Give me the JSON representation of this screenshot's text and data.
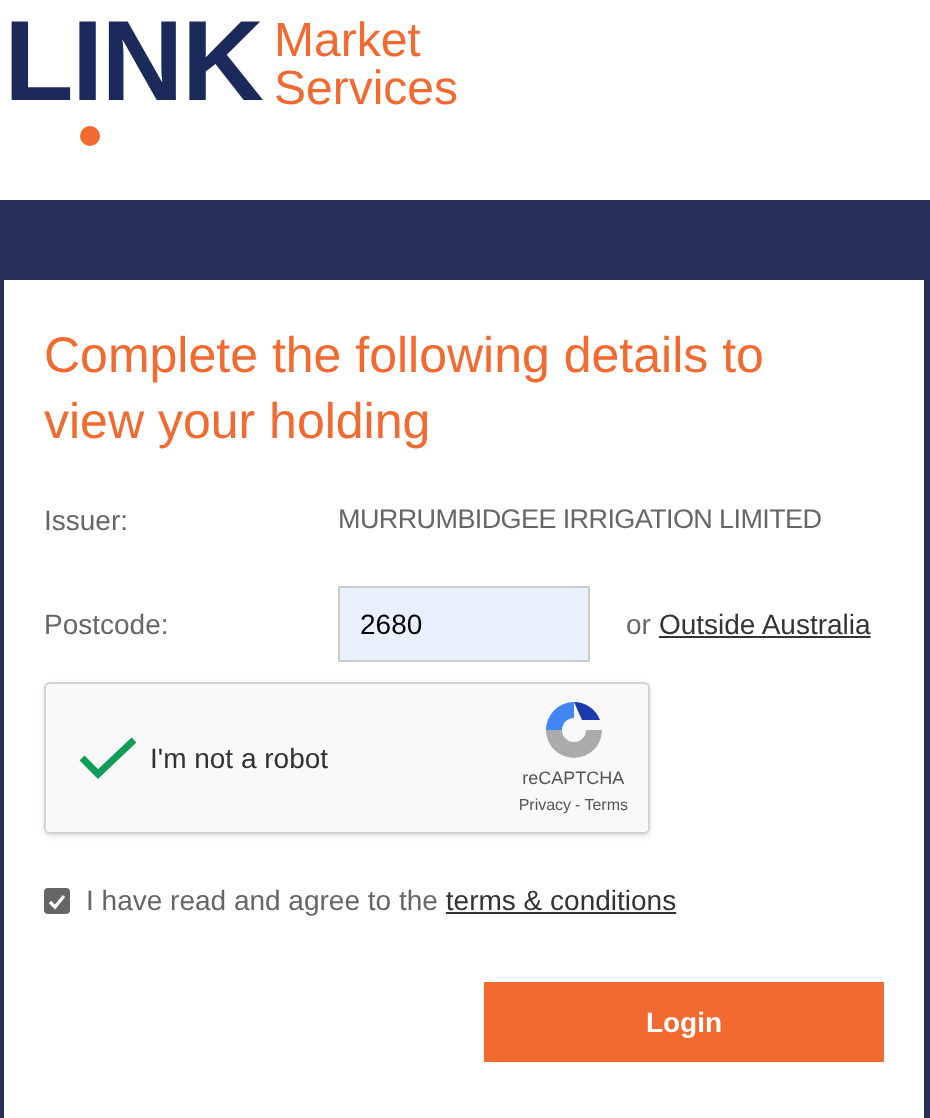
{
  "logo": {
    "word": "LINK",
    "line_1": "Market",
    "line_2": "Services"
  },
  "heading": "Complete the following details to view your holding",
  "issuer": {
    "label": "Issuer:",
    "value": "MURRUMBIDGEE IRRIGATION LIMITED"
  },
  "postcode": {
    "label": "Postcode:",
    "value": "2680",
    "or_text": "or",
    "link": "Outside Australia"
  },
  "captcha": {
    "label": "I'm not a robot",
    "checked": true,
    "brand": "reCAPTCHA",
    "privacy": "Privacy",
    "separator": "-",
    "terms": "Terms"
  },
  "agree": {
    "checked": true,
    "text": "I have read and agree to the",
    "link": "terms & conditions"
  },
  "login_button": "Login"
}
